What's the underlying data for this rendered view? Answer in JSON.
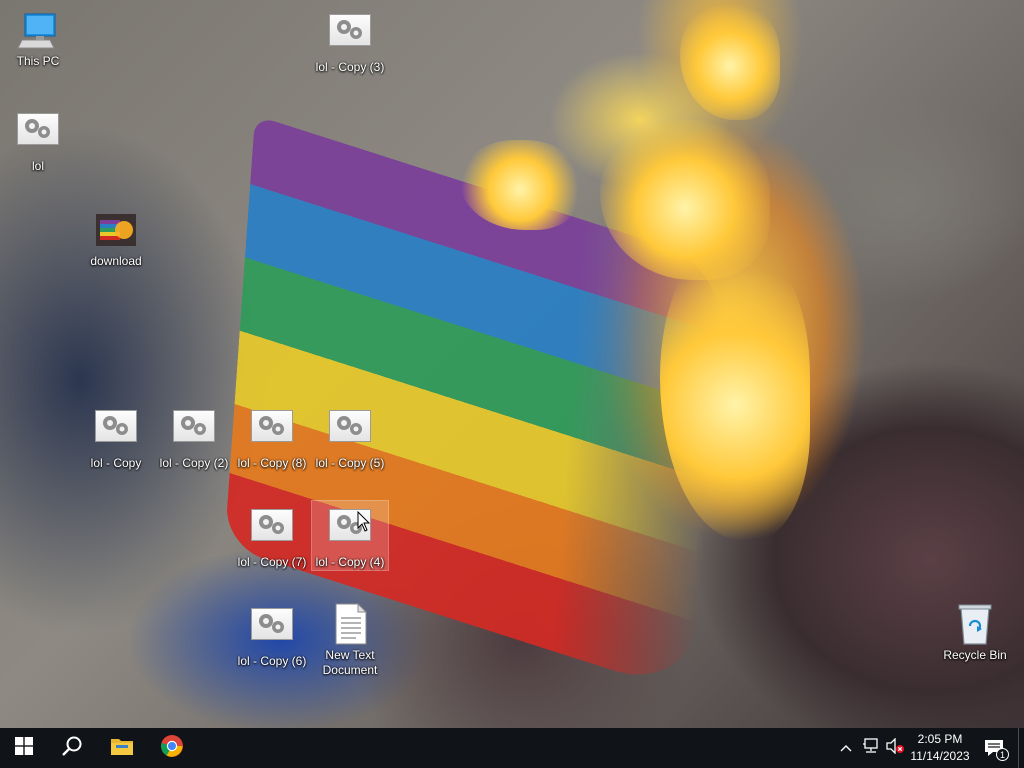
{
  "desktop": {
    "icons": [
      {
        "label": "This PC",
        "icon": "this-pc-icon"
      },
      {
        "label": "lol",
        "icon": "config-file-icon"
      },
      {
        "label": "download",
        "icon": "image-file-icon"
      },
      {
        "label": "lol - Copy (3)",
        "icon": "config-file-icon"
      },
      {
        "label": "lol - Copy",
        "icon": "config-file-icon"
      },
      {
        "label": "lol - Copy (2)",
        "icon": "config-file-icon"
      },
      {
        "label": "lol - Copy (8)",
        "icon": "config-file-icon"
      },
      {
        "label": "lol - Copy (5)",
        "icon": "config-file-icon"
      },
      {
        "label": "lol - Copy (7)",
        "icon": "config-file-icon"
      },
      {
        "label": "lol - Copy (4)",
        "icon": "config-file-icon"
      },
      {
        "label": "lol - Copy (6)",
        "icon": "config-file-icon"
      },
      {
        "label": "New Text Document",
        "icon": "text-document-icon"
      },
      {
        "label": "Recycle Bin",
        "icon": "recycle-bin-icon"
      }
    ],
    "selected_icon": "lol - Copy (4)"
  },
  "taskbar": {
    "start_icon": "windows-start-icon",
    "search_icon": "search-icon",
    "pinned": [
      {
        "name": "File Explorer",
        "icon": "folder-icon"
      },
      {
        "name": "Google Chrome",
        "icon": "chrome-icon"
      }
    ],
    "tray": {
      "show_hidden_icon": "chevron-up-icon",
      "network_icon": "network-icon",
      "volume_icon": "volume-muted-icon",
      "notifications_icon": "notifications-icon",
      "notification_count": "1"
    },
    "clock": {
      "time": "2:05 PM",
      "date": "11/14/2023"
    }
  },
  "colors": {
    "taskbar": "#101317",
    "accent": "#0078d7"
  }
}
